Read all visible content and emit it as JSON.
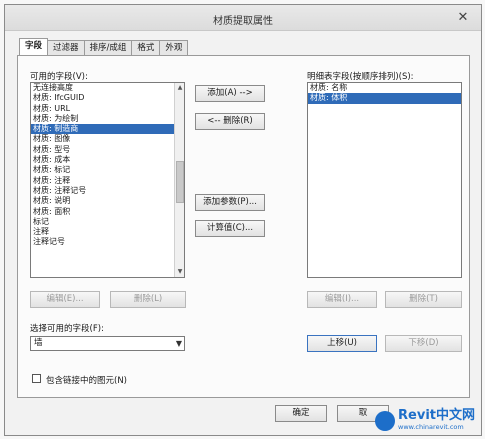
{
  "window": {
    "title": "材质提取属性"
  },
  "tabs": [
    {
      "label": "字段",
      "active": true
    },
    {
      "label": "过滤器"
    },
    {
      "label": "排序/成组"
    },
    {
      "label": "格式"
    },
    {
      "label": "外观"
    }
  ],
  "available": {
    "label": "可用的字段(V):",
    "items": [
      "无连接高度",
      "材质: IfcGUID",
      "材质: URL",
      "材质: 为绘制",
      "材质: 制造商",
      "材质: 图像",
      "材质: 型号",
      "材质: 成本",
      "材质: 标记",
      "材质: 注释",
      "材质: 注释记号",
      "材质: 说明",
      "材质: 面积",
      "标记",
      "注释",
      "注释记号"
    ],
    "selected_index": 4
  },
  "scheduled": {
    "label": "明细表字段(按顺序排列)(S):",
    "items": [
      "材质: 名称",
      "材质: 体积"
    ],
    "selected_index": 1
  },
  "buttons": {
    "add": "添加(A) -->",
    "remove": "<-- 删除(R)",
    "add_param": "添加参数(P)...",
    "calc_value": "计算值(C)...",
    "edit_left": "编辑(E)...",
    "delete_left": "删除(L)",
    "edit_right": "编辑(I)...",
    "delete_right": "删除(T)",
    "move_up": "上移(U)",
    "move_down": "下移(D)",
    "ok": "确定",
    "cancel": "取"
  },
  "select_from": {
    "label": "选择可用的字段(F):",
    "value": "墙"
  },
  "include_linked": {
    "label": "包含链接中的图元(N)",
    "checked": false
  },
  "watermark": {
    "brand": "Revit中文网",
    "url": "www.chinarevit.com"
  }
}
